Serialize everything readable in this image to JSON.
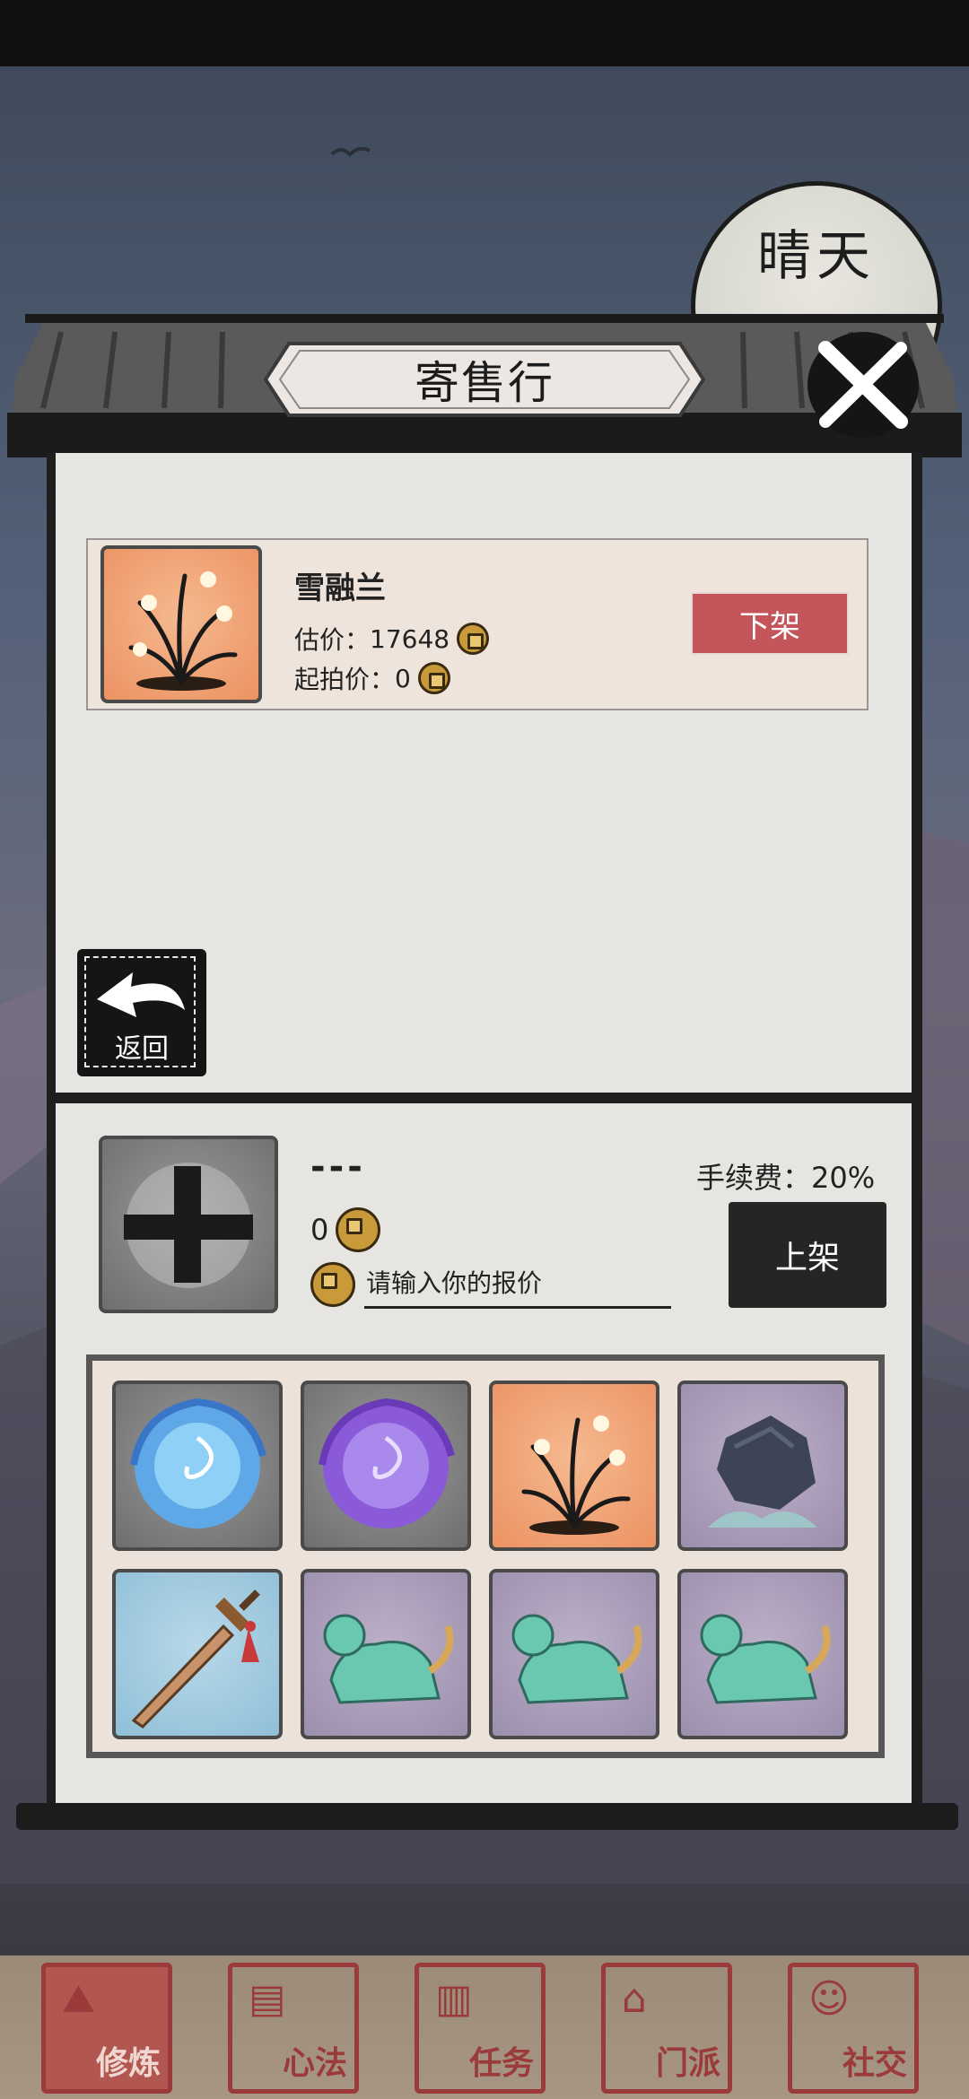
{
  "weather": "晴天",
  "title": "寄售行",
  "listing": {
    "name": "雪融兰",
    "estimate_label": "估价：",
    "estimate_value": "17648",
    "start_label": "起拍价：",
    "start_value": "0",
    "delist_label": "下架",
    "icon": "orchid-icon"
  },
  "back_label": "返回",
  "sell": {
    "item_name": "---",
    "price": "0",
    "fee": "手续费：20%",
    "list_label": "上架",
    "price_placeholder": "请输入你的报价"
  },
  "inventory": [
    {
      "icon": "blue-vortex-icon",
      "bg": "gray"
    },
    {
      "icon": "purple-vortex-icon",
      "bg": "gray"
    },
    {
      "icon": "orchid-icon",
      "bg": "orange"
    },
    {
      "icon": "rock-icon",
      "bg": "purple"
    },
    {
      "icon": "sword-icon",
      "bg": "blue"
    },
    {
      "icon": "beast-icon",
      "bg": "purple"
    },
    {
      "icon": "beast-icon",
      "bg": "purple"
    },
    {
      "icon": "beast-icon",
      "bg": "purple"
    }
  ],
  "nav": [
    {
      "label": "修炼"
    },
    {
      "label": "心法"
    },
    {
      "label": "任务"
    },
    {
      "label": "门派"
    },
    {
      "label": "社交"
    }
  ],
  "colors": {
    "accent_red": "#c4555b",
    "seal_red": "#9b3a3a",
    "ink": "#1e1e1e"
  }
}
